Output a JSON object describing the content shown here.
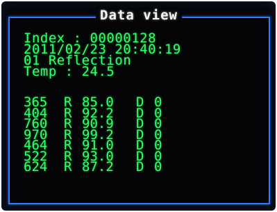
{
  "title": "Data view",
  "info": {
    "index_line": "Index : 00000128",
    "datetime_line": "2011/02/23 20:40:19",
    "mode_line": "01 Reflection",
    "temp_line": "Temp : 24.5"
  },
  "readings": [
    {
      "wavelength": "365",
      "r_label": "R",
      "r_value": "85.0",
      "d_label": "D",
      "d_value": "0"
    },
    {
      "wavelength": "404",
      "r_label": "R",
      "r_value": "92.2",
      "d_label": "D",
      "d_value": "0"
    },
    {
      "wavelength": "760",
      "r_label": "R",
      "r_value": "90.9",
      "d_label": "D",
      "d_value": "0"
    },
    {
      "wavelength": "970",
      "r_label": "R",
      "r_value": "99.2",
      "d_label": "D",
      "d_value": "0"
    },
    {
      "wavelength": "464",
      "r_label": "R",
      "r_value": "91.0",
      "d_label": "D",
      "d_value": "0"
    },
    {
      "wavelength": "522",
      "r_label": "R",
      "r_value": "93.0",
      "d_label": "D",
      "d_value": "0"
    },
    {
      "wavelength": "624",
      "r_label": "R",
      "r_value": "87.2",
      "d_label": "D",
      "d_value": "0"
    }
  ],
  "colors": {
    "background": "#050507",
    "frame": "#2b7cff",
    "text_green": "#33ff66",
    "title_white": "#f4f4f4"
  }
}
